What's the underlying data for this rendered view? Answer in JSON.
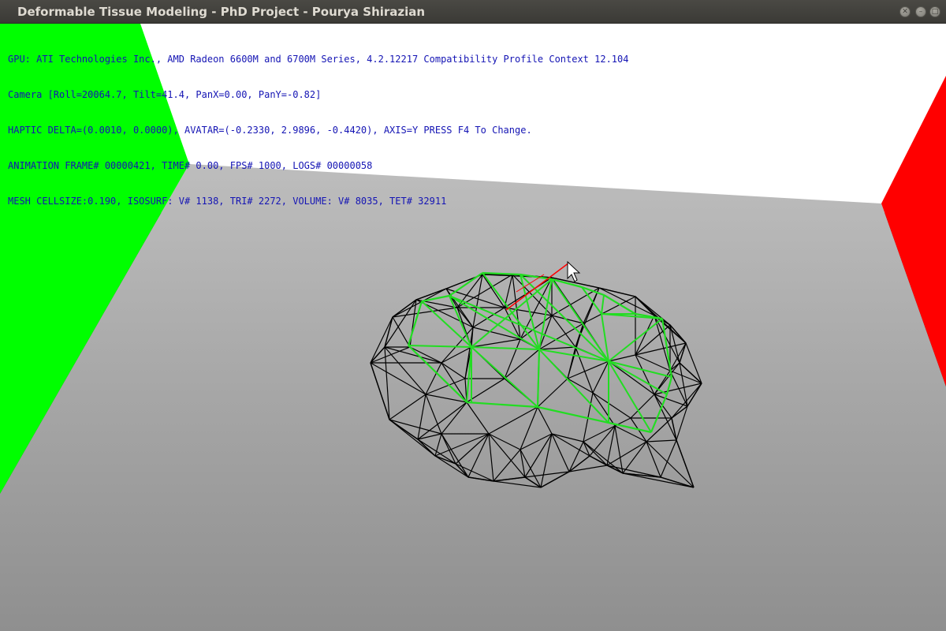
{
  "window": {
    "title": "Deformable Tissue Modeling - PhD Project - Pourya Shirazian",
    "controls": {
      "close_icon": "close-icon",
      "minimize_icon": "minimize-icon",
      "maximize_icon": "maximize-icon"
    }
  },
  "hud": {
    "gpu": "GPU: ATI Technologies Inc., AMD Radeon 6600M and 6700M Series, 4.2.12217 Compatibility Profile Context 12.104",
    "camera": "Camera [Roll=20064.7, Tilt=41.4, PanX=0.00, PanY=-0.82]",
    "haptic": "HAPTIC DELTA=(0.0010, 0.0000), AVATAR=(-0.2330, 2.9896, -0.4420), AXIS=Y PRESS F4 To Change.",
    "animation": "ANIMATION FRAME# 00000421, TIME# 0.00, FPS# 1000, LOGS# 00000058",
    "mesh": "MESH CELLSIZE:0.190, ISOSURF: V# 1138, TRI# 2272, VOLUME: V# 8035, TET# 32911"
  },
  "scene": {
    "colors": {
      "back_wall": "#ffffff",
      "left_wall": "#00ff00",
      "right_wall": "#ff0000",
      "floor_near": "#8f8f8f",
      "floor_far": "#bdbdbd",
      "mesh_wire": "#000000",
      "surface_wire": "#22dd22",
      "avatar_line": "#ff0000",
      "hud_text": "#1414b4"
    },
    "cursor_icon": "arrow-cursor-icon"
  }
}
